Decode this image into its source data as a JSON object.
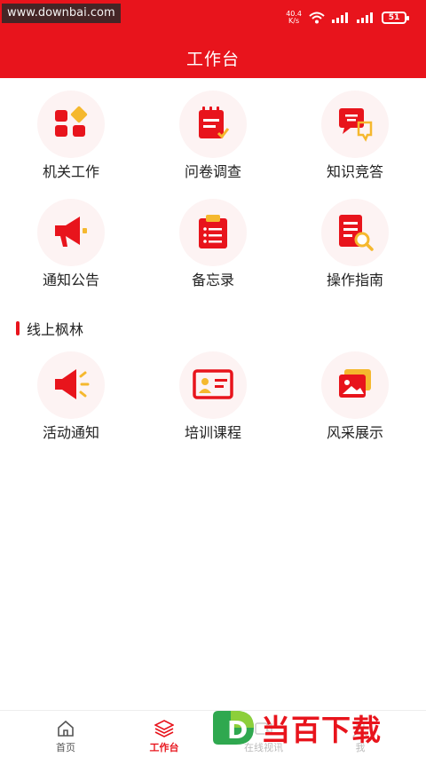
{
  "status_bar": {
    "watermark": "www.downbai.com",
    "net_speed_value": "40.4",
    "net_speed_unit": "K/s",
    "battery": "51"
  },
  "header": {
    "title": "工作台"
  },
  "grid_items": [
    {
      "label": "机关工作",
      "icon": "grid-apps-icon"
    },
    {
      "label": "问卷调查",
      "icon": "notepad-icon"
    },
    {
      "label": "知识竞答",
      "icon": "qa-chat-icon"
    },
    {
      "label": "通知公告",
      "icon": "megaphone-icon"
    },
    {
      "label": "备忘录",
      "icon": "clipboard-list-icon"
    },
    {
      "label": "操作指南",
      "icon": "doc-search-icon"
    }
  ],
  "section": {
    "title": "线上枫林"
  },
  "online_items": [
    {
      "label": "活动通知",
      "icon": "speaker-icon"
    },
    {
      "label": "培训课程",
      "icon": "training-board-icon"
    },
    {
      "label": "风采展示",
      "icon": "photo-gallery-icon"
    }
  ],
  "bottom_nav": [
    {
      "label": "首页",
      "icon": "home-icon",
      "active": false
    },
    {
      "label": "工作台",
      "icon": "layers-icon",
      "active": true
    },
    {
      "label": "在线视讯",
      "icon": "video-icon",
      "active": false
    },
    {
      "label": "我",
      "icon": "user-icon",
      "active": false
    }
  ],
  "overlay_logo": {
    "text": "当百下载",
    "letter": "D"
  },
  "colors": {
    "brand": "#e8141c",
    "accent_yellow": "#f5b82e"
  }
}
